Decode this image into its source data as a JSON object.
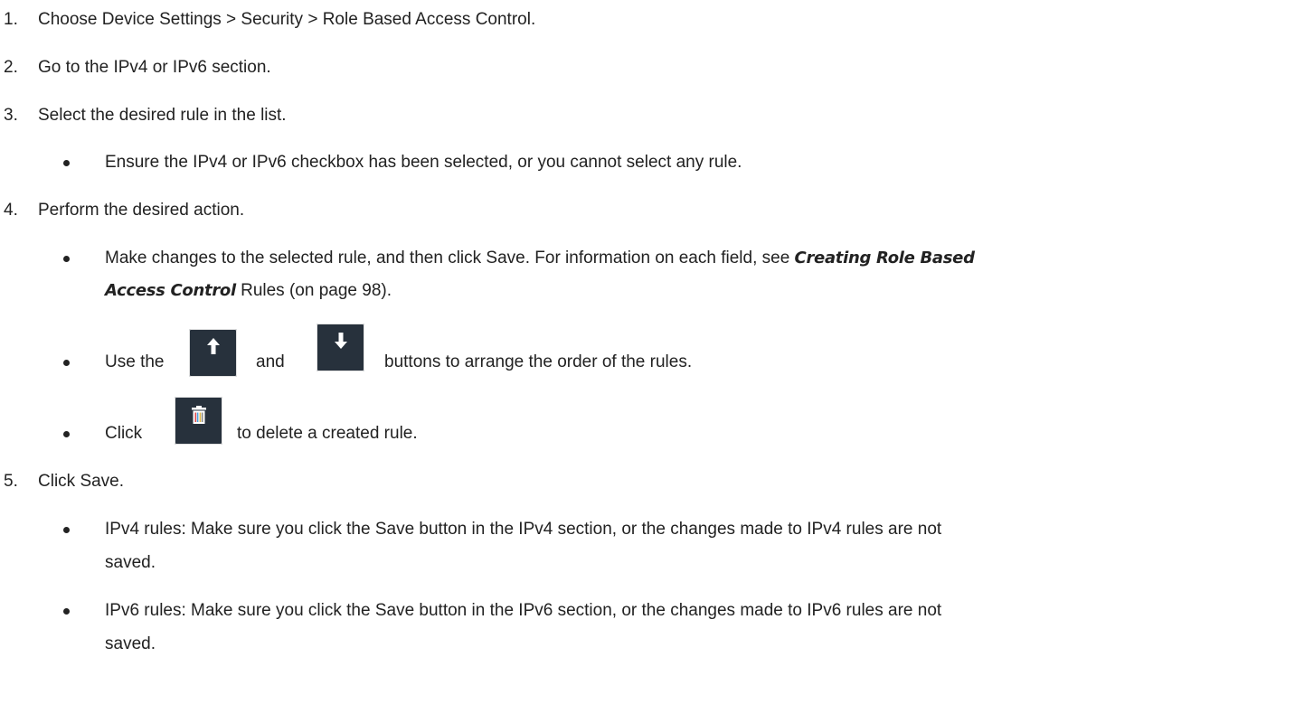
{
  "steps": [
    {
      "num": "1.",
      "text": "Choose Device Settings > Security > Role Based Access Control."
    },
    {
      "num": "2.",
      "text": "Go to the IPv4 or IPv6 section."
    },
    {
      "num": "3.",
      "text": "Select the desired rule in the list."
    },
    {
      "num": "4.",
      "text": "Perform the desired action."
    },
    {
      "num": "5.",
      "text": "Click Save."
    }
  ],
  "step3_bullets": [
    "Ensure the IPv4 or IPv6 checkbox has been selected, or you cannot select any rule."
  ],
  "step4": {
    "bullet1_line1": "Make changes to the selected rule, and then click Save. For information on each field, see ",
    "bullet1_link_a": "Creating Role Based",
    "bullet1_link_b": "Access Control",
    "bullet1_line2_rest": " Rules (on page 98).",
    "bullet2_prefix": "Use the",
    "bullet2_and": "and",
    "bullet2_suffix": "buttons to arrange the order of the rules.",
    "bullet3_prefix": "Click",
    "bullet3_suffix": "to delete a created rule."
  },
  "step5_bullets": [
    {
      "line1": "IPv4 rules: Make sure you click the Save button in the IPv4 section, or the changes made to IPv4 rules are not",
      "line2": "saved."
    },
    {
      "line1": "IPv6 rules: Make sure you click the Save button in the IPv6 section, or the changes made to IPv6 rules are not",
      "line2": "saved."
    }
  ],
  "icons": {
    "up": "arrow-up-icon",
    "down": "arrow-down-icon",
    "delete": "trash-icon"
  },
  "colors": {
    "text": "#222222",
    "button_bg": "#27313c",
    "icon": "#ffffff"
  }
}
